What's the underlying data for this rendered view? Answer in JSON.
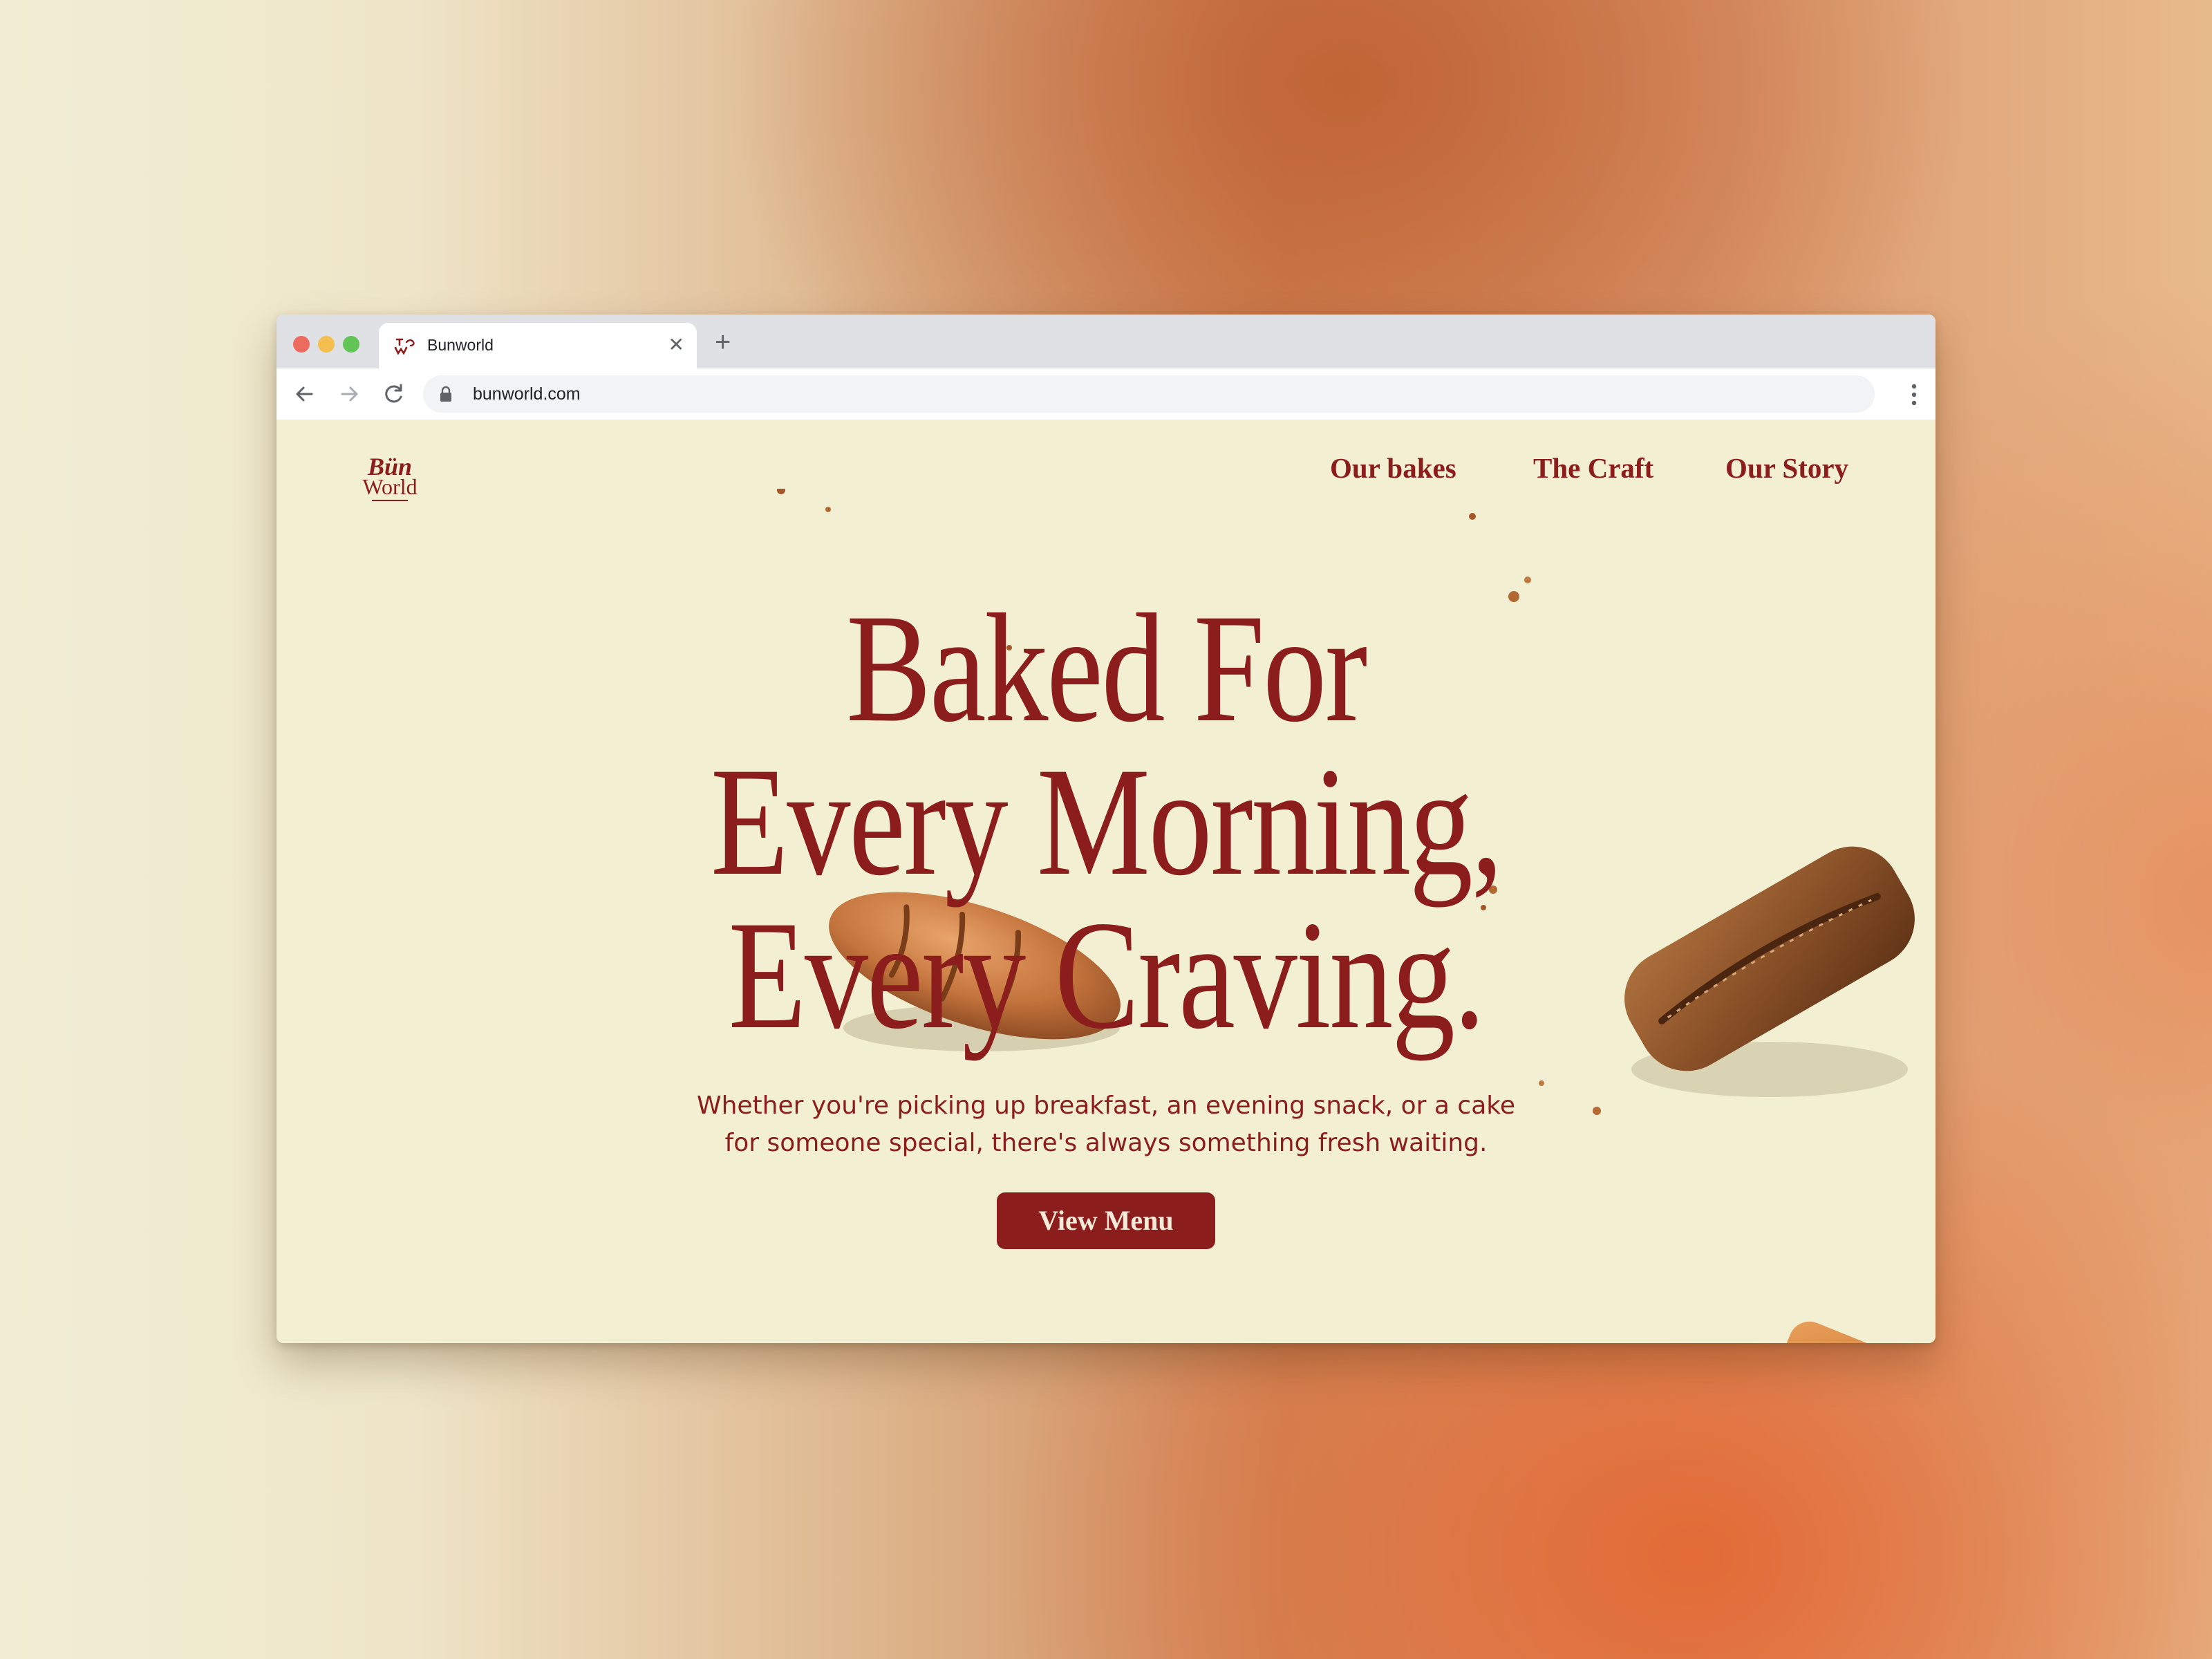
{
  "browser": {
    "tab_title": "Bunworld",
    "new_tab_glyph": "+",
    "close_glyph": "✕",
    "url": "bunworld.com"
  },
  "site": {
    "logo_text": "Bun World",
    "nav": [
      "Our bakes",
      "The Craft",
      "Our Story"
    ],
    "hero_lines": [
      "Baked For",
      "Every Morning,",
      "Every Craving."
    ],
    "subtitle_lines": [
      "Whether you're picking up breakfast, an evening snack, or a cake",
      "for someone special, there's always something fresh waiting."
    ],
    "cta": "View Menu"
  },
  "colors": {
    "brand": "#8c1d1d",
    "page_bg": "#f2efd2",
    "cta_text": "#f6ead8"
  },
  "icons": [
    "back-arrow-icon",
    "forward-arrow-icon",
    "reload-icon",
    "lock-icon",
    "more-menu-icon",
    "close-icon",
    "new-tab-icon"
  ]
}
